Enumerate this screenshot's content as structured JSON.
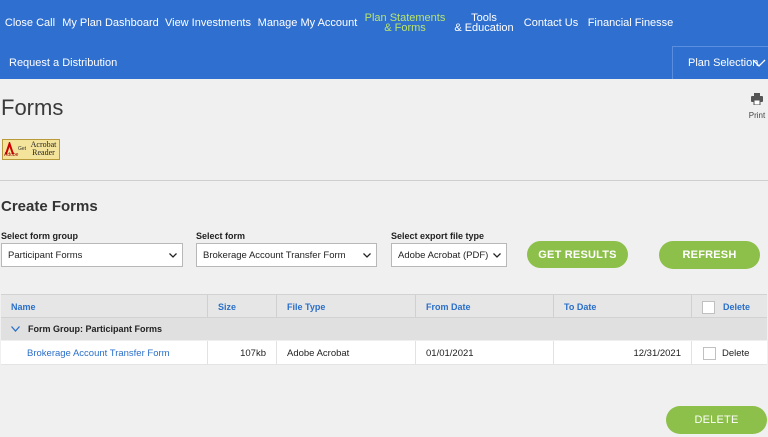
{
  "nav": {
    "items": [
      {
        "label": "Close Call"
      },
      {
        "label": "My Plan Dashboard"
      },
      {
        "label": "View Investments"
      },
      {
        "label": "Manage My Account"
      },
      {
        "label1": "Plan Statements",
        "label2": "& Forms"
      },
      {
        "label1": "Tools",
        "label2": "& Education"
      },
      {
        "label": "Contact Us"
      },
      {
        "label": "Financial Finesse"
      }
    ],
    "distribution": "Request a Distribution",
    "plan_selection": "Plan Selection",
    "active_color": "#b9e46a",
    "bar_color": "#2f6fd0"
  },
  "page": {
    "title": "Forms",
    "print_label": "Print",
    "acrobat": {
      "adobe": "Adobe",
      "get": "Get",
      "brand1": "Acrobat",
      "brand2": "Reader"
    }
  },
  "create": {
    "title": "Create Forms",
    "group_label": "Select form group",
    "group_value": "Participant Forms",
    "form_label": "Select form",
    "form_value": "Brokerage Account Transfer Form",
    "export_label": "Select export file type",
    "export_value": "Adobe Acrobat (PDF)",
    "get_results": "GET RESULTS",
    "refresh": "REFRESH",
    "button_color": "#8dc04a"
  },
  "table": {
    "headers": {
      "name": "Name",
      "size": "Size",
      "file_type": "File Type",
      "from_date": "From Date",
      "to_date": "To Date",
      "delete": "Delete"
    },
    "group": "Form Group: Participant Forms",
    "rows": [
      {
        "name": "Brokerage Account Transfer Form",
        "size": "107kb",
        "file_type": "Adobe Acrobat",
        "from_date": "01/01/2021",
        "to_date": "12/31/2021",
        "delete": "Delete"
      }
    ]
  },
  "footer": {
    "delete_button": "DELETE"
  }
}
